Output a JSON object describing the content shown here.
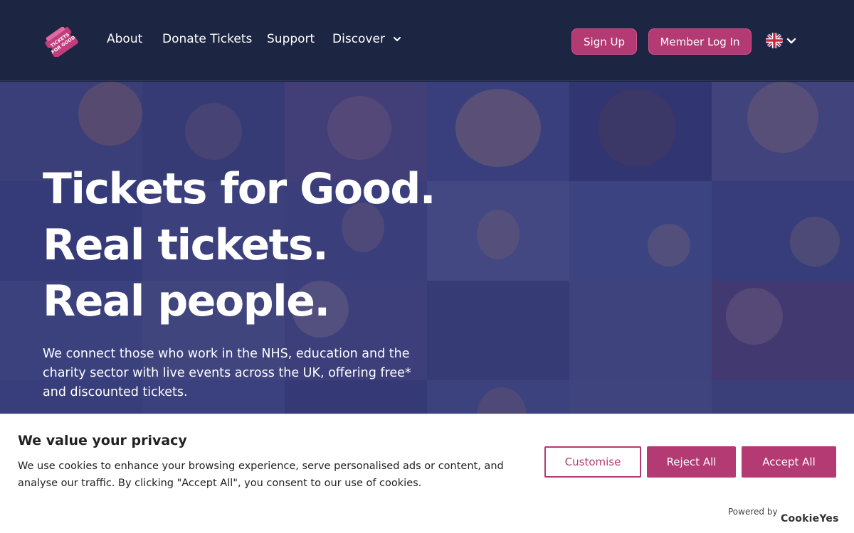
{
  "header": {
    "logo_label": "TICKETS FOR GOOD",
    "nav": {
      "about": "About",
      "donate": "Donate Tickets",
      "support": "Support",
      "discover": "Discover"
    },
    "signup_label": "Sign Up",
    "login_label": "Member Log In",
    "language_icon": "uk-flag-icon"
  },
  "hero": {
    "line1": "Tickets for Good.",
    "line2": "Real tickets.",
    "line3": "Real people.",
    "subtext": "We connect those who work in the NHS, education and the charity sector with live events across the UK, offering free* and discounted tickets."
  },
  "cookie": {
    "title": "We value your privacy",
    "text": "We use cookies to enhance your browsing experience, serve personalised ads or content, and analyse our traffic. By clicking \"Accept All\", you consent to our use of cookies.",
    "customise_label": "Customise",
    "reject_label": "Reject All",
    "accept_label": "Accept All",
    "powered_by": "Powered by",
    "brand": "CookieYes"
  },
  "colors": {
    "header_bg": "#1c2542",
    "accent": "#b43a73",
    "overlay": "#282c6e"
  }
}
